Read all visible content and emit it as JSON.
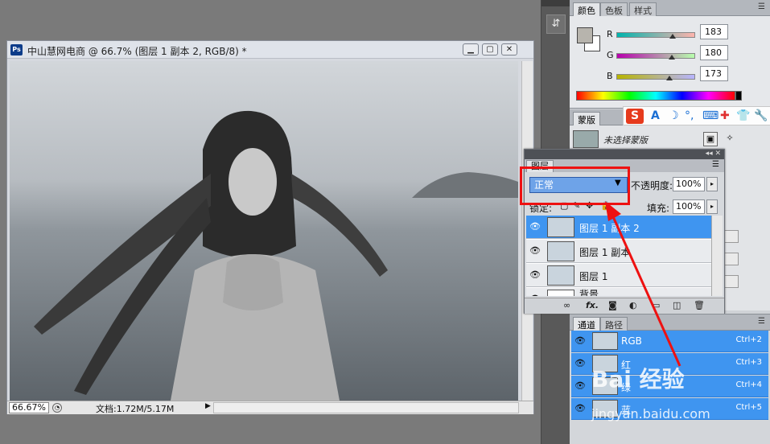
{
  "document": {
    "title": "中山慧网电商 @ 66.7% (图层 1 副本 2, RGB/8) *",
    "app_icon": "Ps",
    "zoom": "66.67%",
    "doc_info": "文档:1.72M/5.17M"
  },
  "color_panel": {
    "tabs": [
      "颜色",
      "色板",
      "样式"
    ],
    "channels": [
      {
        "label": "R",
        "value": "183",
        "fraction": 0.72
      },
      {
        "label": "G",
        "value": "180",
        "fraction": 0.71
      },
      {
        "label": "B",
        "value": "173",
        "fraction": 0.68
      }
    ],
    "foreground": "#b7b4ad",
    "background": "#ffffff"
  },
  "mask_panel": {
    "tabs": [
      "蒙版"
    ],
    "text": "未选择蒙版"
  },
  "ime": {
    "logo": "S",
    "icons": [
      "A",
      "☽",
      "°,",
      "⌨",
      "✚",
      "👕",
      "🔧"
    ]
  },
  "layers_panel": {
    "tab": "图层",
    "blend_mode": "正常",
    "opacity_label": "不透明度:",
    "opacity_value": "100%",
    "lock_label": "锁定:",
    "fill_label": "填充:",
    "fill_value": "100%",
    "layers": [
      {
        "name": "图层 1 副本 2",
        "selected": true
      },
      {
        "name": "图层 1 副本",
        "selected": false
      },
      {
        "name": "图层 1",
        "selected": false
      },
      {
        "name": "背景",
        "selected": false
      }
    ]
  },
  "channels_panel": {
    "tabs": [
      "通道",
      "路径"
    ],
    "channels": [
      {
        "name": "RGB",
        "shortcut": "Ctrl+2"
      },
      {
        "name": "红",
        "shortcut": "Ctrl+3"
      },
      {
        "name": "绿",
        "shortcut": "Ctrl+4"
      },
      {
        "name": "蓝",
        "shortcut": "Ctrl+5"
      }
    ]
  },
  "watermark": {
    "line1": "Bai 经验",
    "line2": "jingyan.baidu.com"
  },
  "colors": {
    "selection": "#3f95f0",
    "annotation": "#ee1111"
  }
}
